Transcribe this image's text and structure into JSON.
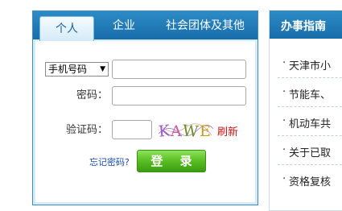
{
  "login": {
    "tabs": [
      "个人",
      "企业",
      "社会团体及其他"
    ],
    "account_type": {
      "selected": "手机号码"
    },
    "account_value": "",
    "password_label": "密码：",
    "password_value": "",
    "captcha_label": "验证码：",
    "captcha_value": "",
    "captcha_text": "KAWE",
    "refresh_label": "刷新",
    "forgot_label": "忘记密码?",
    "login_button": "登 录"
  },
  "guide": {
    "title": "办事指南",
    "items": [
      "天津市小",
      "节能车、",
      "机动车共",
      "关于已取",
      "资格复核"
    ]
  },
  "colors": {
    "header_blue": "#1f78b4",
    "login_green": "#4cb41e",
    "refresh_red": "#cc1111",
    "link_blue": "#1b4ea6"
  }
}
